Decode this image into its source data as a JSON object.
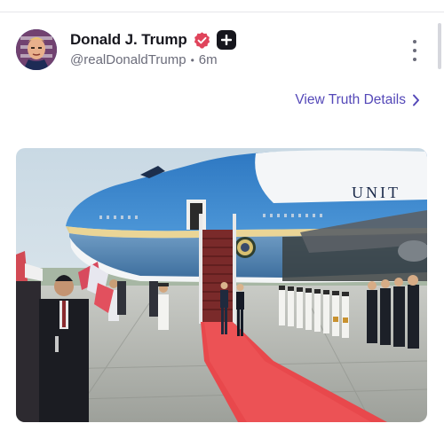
{
  "post": {
    "author": {
      "display_name": "Donald J. Trump",
      "handle": "@realDonaldTrump",
      "verified_icon": "verified-badge-icon",
      "badge_icon": "plus-badge-icon"
    },
    "time_ago": "6m",
    "separator": "•",
    "more_icon": "vertical-ellipsis-icon",
    "details_link": "View Truth Details",
    "details_icon": "chevron-right-icon",
    "image_text": "UNIT"
  },
  "colors": {
    "accent": "#5448b8",
    "verified": "#e0445b",
    "text_primary": "#16161d",
    "text_secondary": "#6b6c7a",
    "carpet": "#e8434a",
    "aircraft_blue": "#3a84c9"
  }
}
